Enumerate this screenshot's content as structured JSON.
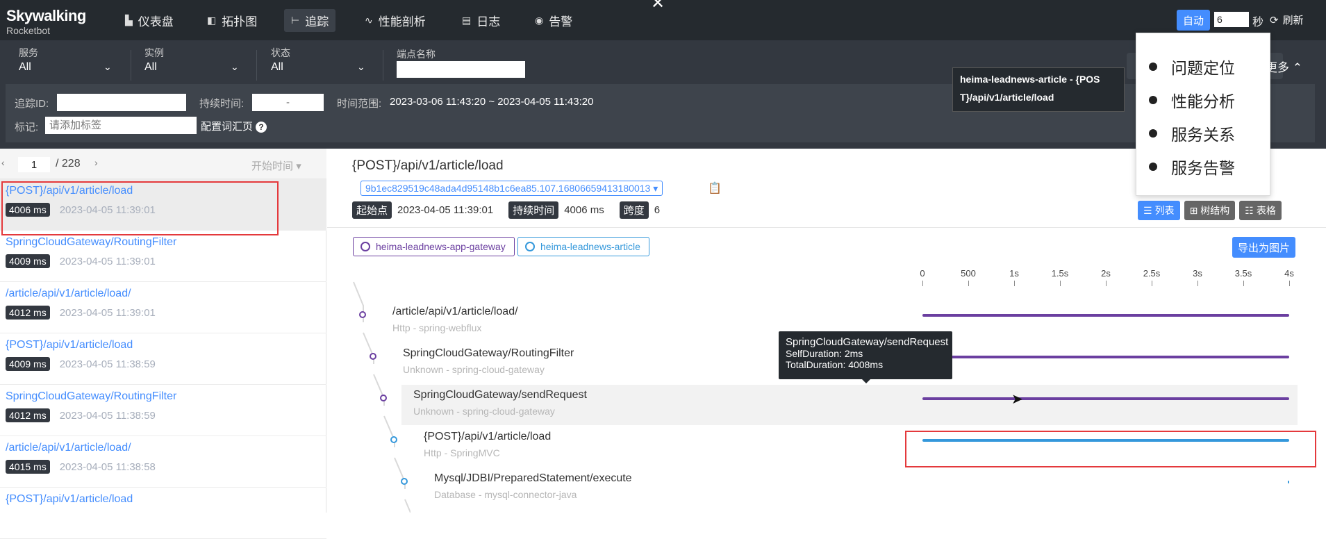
{
  "app": {
    "brand": "Skywalking",
    "sub": "Rocketbot",
    "close": "✕"
  },
  "nav": {
    "items": [
      {
        "label": "仪表盘",
        "icon": "dashboard-icon",
        "glyph": "▙"
      },
      {
        "label": "拓扑图",
        "icon": "topology-icon",
        "glyph": "◧"
      },
      {
        "label": "追踪",
        "icon": "trace-icon",
        "glyph": "⊢"
      },
      {
        "label": "性能剖析",
        "icon": "profile-icon",
        "glyph": "∿"
      },
      {
        "label": "日志",
        "icon": "log-icon",
        "glyph": "▤"
      },
      {
        "label": "告警",
        "icon": "alarm-icon",
        "glyph": "◉"
      }
    ],
    "auto_label": "自动",
    "interval_value": "6",
    "seconds_label": "秒",
    "refresh_label": "刷新"
  },
  "filters": {
    "service_label": "服务",
    "service_value": "All",
    "instance_label": "实例",
    "instance_value": "All",
    "status_label": "状态",
    "status_value": "All",
    "endpoint_label": "端点名称",
    "more_label": "更多",
    "traceid_label": "追踪ID:",
    "duration_label": "持续时间:",
    "duration_placeholder": "-",
    "timerange_label": "时间范围:",
    "timerange_value": "2023-03-06 11:43:20 ~ 2023-04-05 11:43:20",
    "tag_label": "标记:",
    "tag_placeholder": "请添加标签",
    "config_label": "配置词汇页",
    "help": "?"
  },
  "hover_tip": {
    "line1": "heima-leadnews-article - {POS",
    "line2": "T}/api/v1/article/load"
  },
  "popup_menu": [
    "问题定位",
    "性能分析",
    "服务关系",
    "服务告警"
  ],
  "list": {
    "page": "1",
    "total": "/ 228",
    "sort_label": "开始时间",
    "items": [
      {
        "endpoint": "{POST}/api/v1/article/load",
        "duration": "4006 ms",
        "time": "2023-04-05 11:39:01"
      },
      {
        "endpoint": "SpringCloudGateway/RoutingFilter",
        "duration": "4009 ms",
        "time": "2023-04-05 11:39:01"
      },
      {
        "endpoint": "/article/api/v1/article/load/",
        "duration": "4012 ms",
        "time": "2023-04-05 11:39:01"
      },
      {
        "endpoint": "{POST}/api/v1/article/load",
        "duration": "4009 ms",
        "time": "2023-04-05 11:38:59"
      },
      {
        "endpoint": "SpringCloudGateway/RoutingFilter",
        "duration": "4012 ms",
        "time": "2023-04-05 11:38:59"
      },
      {
        "endpoint": "/article/api/v1/article/load/",
        "duration": "4015 ms",
        "time": "2023-04-05 11:38:58"
      },
      {
        "endpoint": "{POST}/api/v1/article/load",
        "duration": "",
        "time": ""
      }
    ]
  },
  "detail": {
    "title": "{POST}/api/v1/article/load",
    "trace_id": "9b1ec829519c48ada4d95148b1c6ea85.107.16806659413180013",
    "start_label": "起始点",
    "start_value": "2023-04-05 11:39:01",
    "duration_label": "持续时间",
    "duration_value": "4006 ms",
    "span_label": "跨度",
    "span_value": "6",
    "view_list": "列表",
    "view_tree": "树结构",
    "view_table": "表格",
    "services": [
      "heima-leadnews-app-gateway",
      "heima-leadnews-article"
    ],
    "export_label": "导出为图片",
    "axis": [
      "0",
      "500",
      "1s",
      "1.5s",
      "2s",
      "2.5s",
      "3s",
      "3.5s",
      "4s"
    ],
    "spans": [
      {
        "name": "/article/api/v1/article/load/",
        "sub": "Http - spring-webflux",
        "color": "#6b3fa0"
      },
      {
        "name": "SpringCloudGateway/RoutingFilter",
        "sub": "Unknown - spring-cloud-gateway",
        "color": "#6b3fa0"
      },
      {
        "name": "SpringCloudGateway/sendRequest",
        "sub": "Unknown - spring-cloud-gateway",
        "color": "#6b3fa0"
      },
      {
        "name": "{POST}/api/v1/article/load",
        "sub": "Http - SpringMVC",
        "color": "#3498db"
      },
      {
        "name": "Mysql/JDBI/PreparedStatement/execute",
        "sub": "Database - mysql-connector-java",
        "color": "#3498db"
      }
    ],
    "tooltip": {
      "name": "SpringCloudGateway/sendRequest",
      "self": "SelfDuration: 2ms",
      "total": "TotalDuration: 4008ms"
    }
  },
  "colors": {
    "accent": "#448dfe",
    "gateway": "#6b3fa0",
    "article": "#3498db",
    "highlight": "#e4393c"
  }
}
